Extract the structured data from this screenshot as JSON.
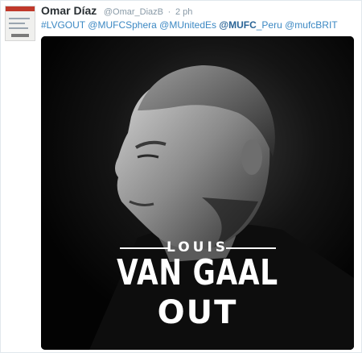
{
  "tweet": {
    "author_name": "Omar Díaz",
    "author_handle": "@Omar_DiazB",
    "separator": "·",
    "timestamp": "2 ph",
    "text_parts": [
      {
        "text": "#LVGOUT",
        "kind": "hashtag"
      },
      {
        "text": " ",
        "kind": "space"
      },
      {
        "text": "@MUFCSphera",
        "kind": "mention"
      },
      {
        "text": " ",
        "kind": "space"
      },
      {
        "text": "@MUnitedEs",
        "kind": "mention"
      },
      {
        "text": " ",
        "kind": "space"
      },
      {
        "text": "@MUFC",
        "kind": "mention-strong"
      },
      {
        "text": "_Peru",
        "kind": "mention"
      },
      {
        "text": " ",
        "kind": "space"
      },
      {
        "text": "@mufcBRIT",
        "kind": "mention"
      }
    ]
  },
  "poster": {
    "first_name": "LOUIS",
    "last_name": "VAN GAAL",
    "tagline": "OUT"
  },
  "colors": {
    "link": "#3b88c3",
    "name": "#292f33",
    "meta": "#8899a6",
    "poster_bg": "#050505"
  }
}
